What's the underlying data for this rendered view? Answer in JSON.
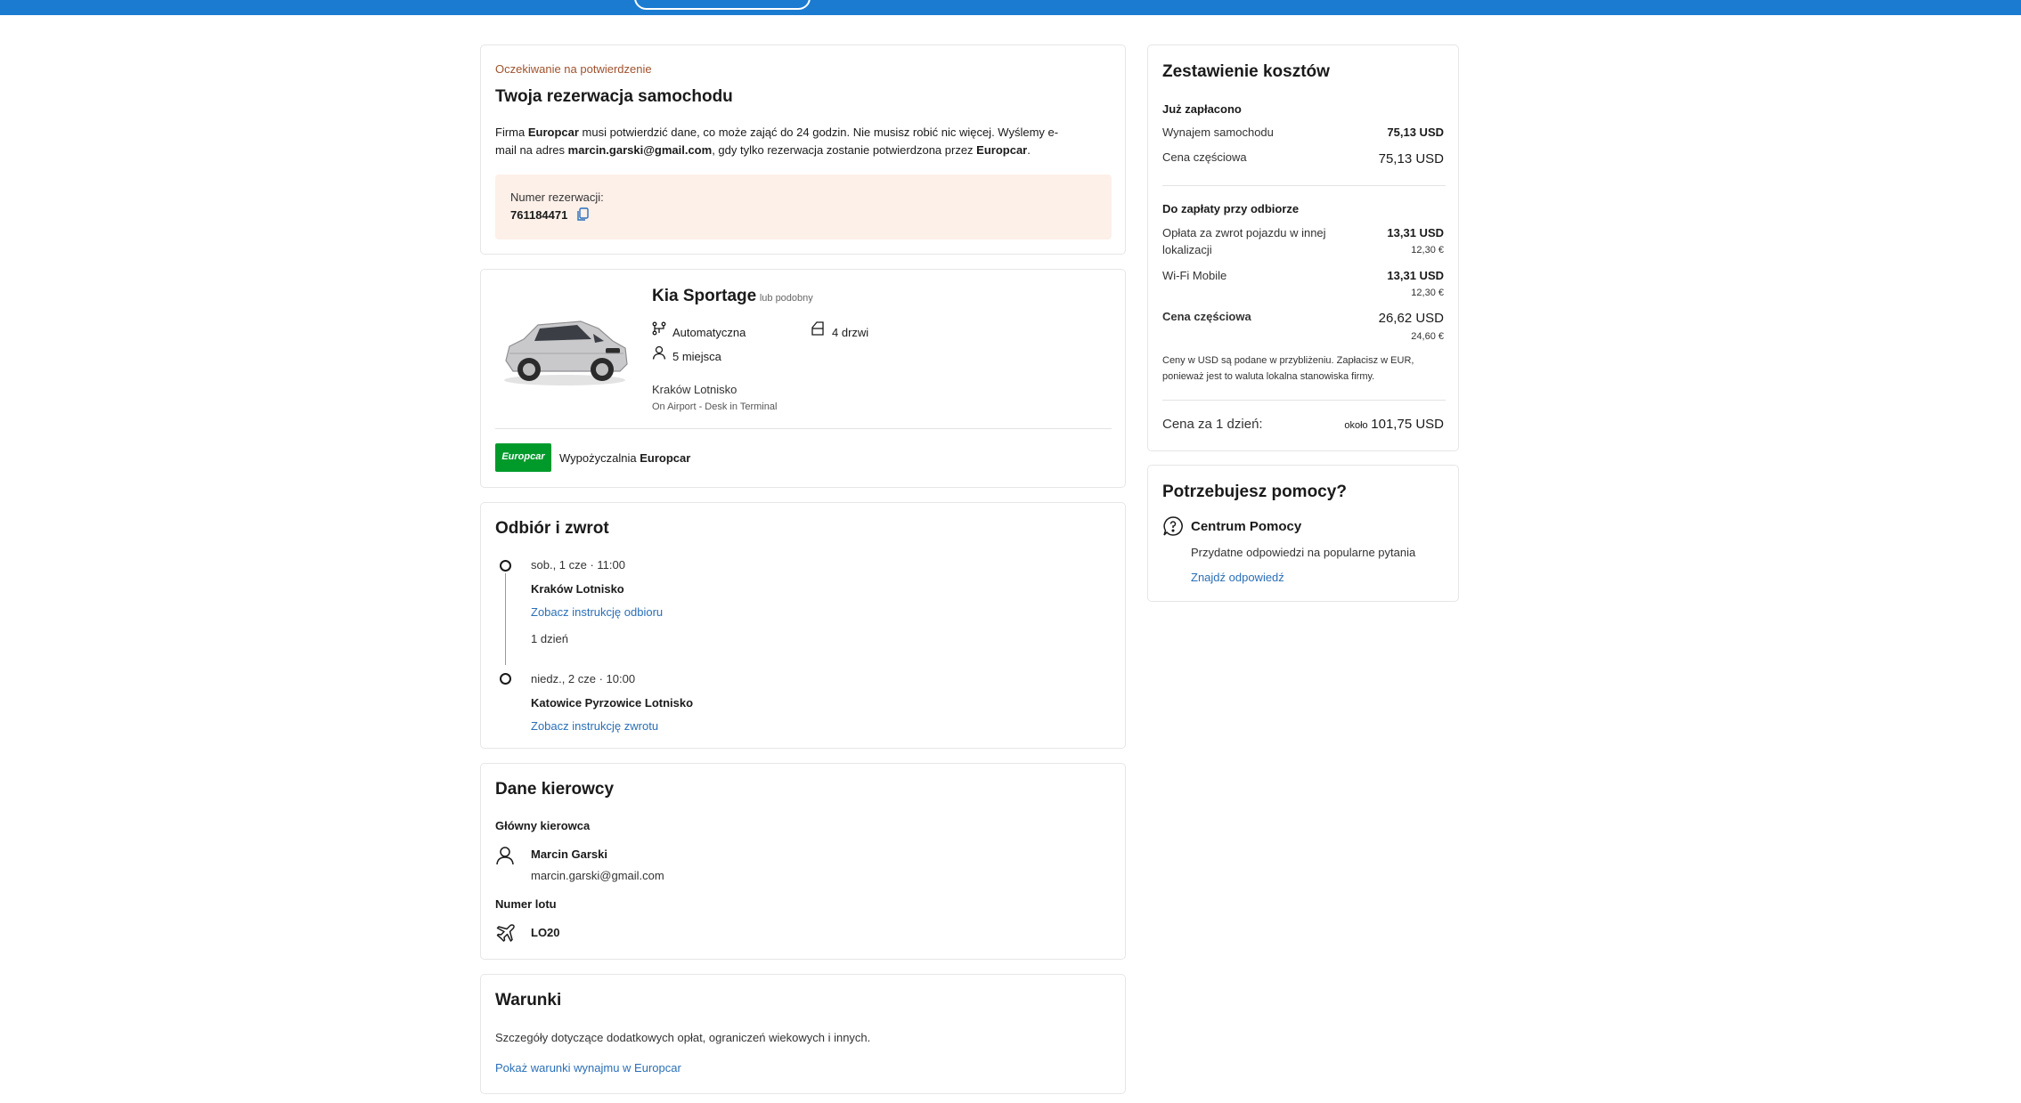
{
  "confirmation": {
    "status": "Oczekiwanie na potwierdzenie",
    "title": "Twoja rezerwacja samochodu",
    "line1_prefix": "Firma ",
    "company": "Europcar",
    "line1_suffix": " musi potwierdzić dane, co może zająć do 24 godzin. Nie musisz robić nic więcej. Wyślemy e-",
    "line2_prefix": "mail na adres ",
    "email": "marcin.garski@gmail.com",
    "line2_middle": ", gdy tylko rezerwacja zostanie potwierdzona przez ",
    "line2_end": ".",
    "reservation_label": "Numer rezerwacji:",
    "reservation_number": "761184471"
  },
  "car": {
    "name": "Kia Sportage",
    "similar": "lub podobny",
    "transmission": "Automatyczna",
    "doors": "4 drzwi",
    "seats": "5 miejsca",
    "location": "Kraków Lotnisko",
    "location_detail": "On Airport - Desk in Terminal",
    "supplier_logo_text": "Europcar",
    "supplier_prefix": "Wypożyczalnia ",
    "supplier_name": "Europcar"
  },
  "pickup_return": {
    "title": "Odbiór i zwrot",
    "pickup_time": "sob., 1 cze · 11:00",
    "pickup_location": "Kraków Lotnisko",
    "pickup_link": "Zobacz instrukcję odbioru",
    "duration": "1 dzień",
    "return_time": "niedz., 2 cze · 10:00",
    "return_location": "Katowice Pyrzowice Lotnisko",
    "return_link": "Zobacz instrukcję zwrotu"
  },
  "driver": {
    "title": "Dane kierowcy",
    "main_driver_label": "Główny kierowca",
    "name": "Marcin Garski",
    "email": "marcin.garski@gmail.com",
    "flight_label": "Numer lotu",
    "flight_number": "LO20"
  },
  "terms": {
    "title": "Warunki",
    "description": "Szczegóły dotyczące dodatkowych opłat, ograniczeń wiekowych i innych.",
    "link": "Pokaż warunki wynajmu w Europcar"
  },
  "costs": {
    "title": "Zestawienie kosztów",
    "paid_label": "Już zapłacono",
    "rental_label": "Wynajem samochodu",
    "rental_value": "75,13 USD",
    "partial1_label": "Cena częściowa",
    "partial1_value": "75,13 USD",
    "due_label": "Do zapłaty przy odbiorze",
    "oneway_label_1": "Opłata za zwrot pojazdu w innej",
    "oneway_label_2": "lokalizacji",
    "oneway_value": "13,31 USD",
    "oneway_eur": "12,30 €",
    "wifi_label": "Wi-Fi Mobile",
    "wifi_value": "13,31 USD",
    "wifi_eur": "12,30 €",
    "partial2_label": "Cena częściowa",
    "partial2_value": "26,62 USD",
    "partial2_eur": "24,60 €",
    "note_1": "Ceny w USD są podane w przybliżeniu. Zapłacisz w EUR,",
    "note_2": "ponieważ jest to waluta lokalna stanowiska firmy.",
    "per_day_label": "Cena za 1 dzień:",
    "per_day_approx": "około",
    "per_day_value": "101,75 USD"
  },
  "help": {
    "title": "Potrzebujesz pomocy?",
    "center_label": "Centrum Pomocy",
    "center_desc": "Przydatne odpowiedzi na popularne pytania",
    "link": "Znajdź odpowiedź"
  },
  "colors": {
    "topbar": "#1b7bd1",
    "link": "#2a6fb8",
    "status": "#a0522d",
    "reservation_bg": "#fdf0e9",
    "europcar_green": "#009a2b"
  }
}
